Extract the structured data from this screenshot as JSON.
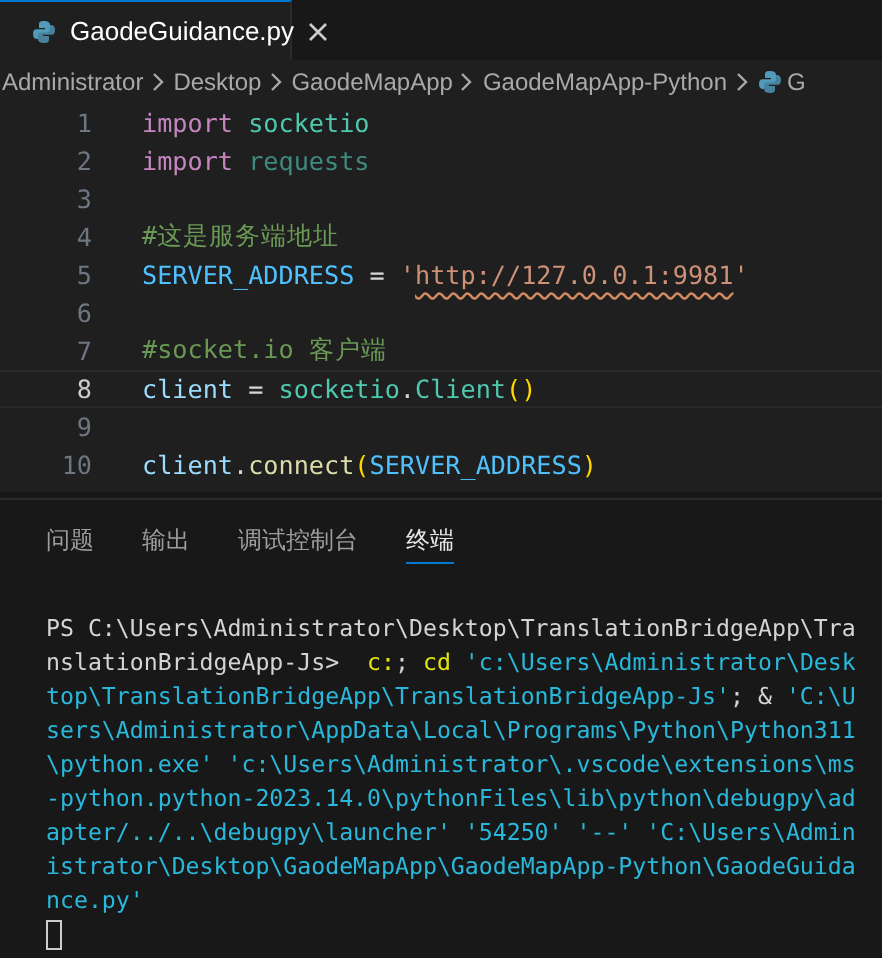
{
  "editor_tab": {
    "label": "GaodeGuidance.py",
    "selected": true
  },
  "breadcrumb": [
    "Administrator",
    "Desktop",
    "GaodeMapApp",
    "GaodeMapApp-Python",
    "G"
  ],
  "code_lines": [
    {
      "number": "1",
      "current": false,
      "tokens": [
        {
          "kind": "keyword",
          "text": "import "
        },
        {
          "kind": "module",
          "text": "socketio"
        }
      ]
    },
    {
      "number": "2",
      "current": false,
      "tokens": [
        {
          "kind": "keyword",
          "text": "import "
        },
        {
          "kind": "unused",
          "text": "requests"
        }
      ]
    },
    {
      "number": "3",
      "current": false
    },
    {
      "number": "4",
      "current": false,
      "tokens": [
        {
          "kind": "comment",
          "text": "#这是服务端地址"
        }
      ]
    },
    {
      "number": "5",
      "current": false,
      "tokens": [
        {
          "kind": "constant",
          "text": "SERVER_ADDRESS"
        },
        {
          "kind": "plain",
          "text": " = "
        },
        {
          "kind": "string",
          "text": "'"
        },
        {
          "kind": "url",
          "text": "http://127.0.0.1:9981"
        },
        {
          "kind": "string",
          "text": "'"
        }
      ]
    },
    {
      "number": "6",
      "current": false
    },
    {
      "number": "7",
      "current": false,
      "tokens": [
        {
          "kind": "comment",
          "text": "#socket.io 客户端"
        }
      ]
    },
    {
      "number": "8",
      "current": true,
      "tokens": [
        {
          "kind": "variable",
          "text": "client"
        },
        {
          "kind": "plain",
          "text": " = "
        },
        {
          "kind": "module",
          "text": "socketio"
        },
        {
          "kind": "plain",
          "text": "."
        },
        {
          "kind": "module",
          "text": "Client"
        },
        {
          "kind": "paren",
          "text": "()"
        }
      ]
    },
    {
      "number": "9",
      "current": false
    },
    {
      "number": "10",
      "current": false,
      "tokens": [
        {
          "kind": "variable",
          "text": "client"
        },
        {
          "kind": "plain",
          "text": "."
        },
        {
          "kind": "function",
          "text": "connect"
        },
        {
          "kind": "paren",
          "text": "("
        },
        {
          "kind": "constant",
          "text": "SERVER_ADDRESS"
        },
        {
          "kind": "paren",
          "text": ")"
        }
      ]
    }
  ],
  "panel_tabs": [
    {
      "label": "问题",
      "selected": false
    },
    {
      "label": "输出",
      "selected": false
    },
    {
      "label": "调试控制台",
      "selected": false
    },
    {
      "label": "终端",
      "selected": true
    }
  ],
  "terminal_lines": [
    [
      {
        "kind": "plain",
        "text": "PS C:\\Users\\Administrator\\Desktop\\TranslationBridgeApp\\Tra"
      }
    ],
    [
      {
        "kind": "plain",
        "text": "nslationBridgeApp-Js>  "
      },
      {
        "kind": "command",
        "text": "c:"
      },
      {
        "kind": "plain",
        "text": "; "
      },
      {
        "kind": "command",
        "text": "cd"
      },
      {
        "kind": "arg",
        "text": " 'c:\\Users\\Administrator\\Desk"
      }
    ],
    [
      {
        "kind": "arg",
        "text": "top\\TranslationBridgeApp\\TranslationBridgeApp-Js'"
      },
      {
        "kind": "plain",
        "text": "; & "
      },
      {
        "kind": "arg",
        "text": "'C:\\U"
      }
    ],
    [
      {
        "kind": "arg",
        "text": "sers\\Administrator\\AppData\\Local\\Programs\\Python\\Python311"
      }
    ],
    [
      {
        "kind": "arg",
        "text": "\\python.exe' 'c:\\Users\\Administrator\\.vscode\\extensions\\ms"
      }
    ],
    [
      {
        "kind": "arg",
        "text": "-python.python-2023.14.0\\pythonFiles\\lib\\python\\debugpy\\ad"
      }
    ],
    [
      {
        "kind": "arg",
        "text": "apter/../..\\debugpy\\launcher' '54250' '--' 'C:\\Users\\Admin"
      }
    ],
    [
      {
        "kind": "arg",
        "text": "istrator\\Desktop\\GaodeMapApp\\GaodeMapApp-Python\\GaodeGuida"
      }
    ],
    [
      {
        "kind": "arg",
        "text": "nce.py'"
      }
    ]
  ]
}
